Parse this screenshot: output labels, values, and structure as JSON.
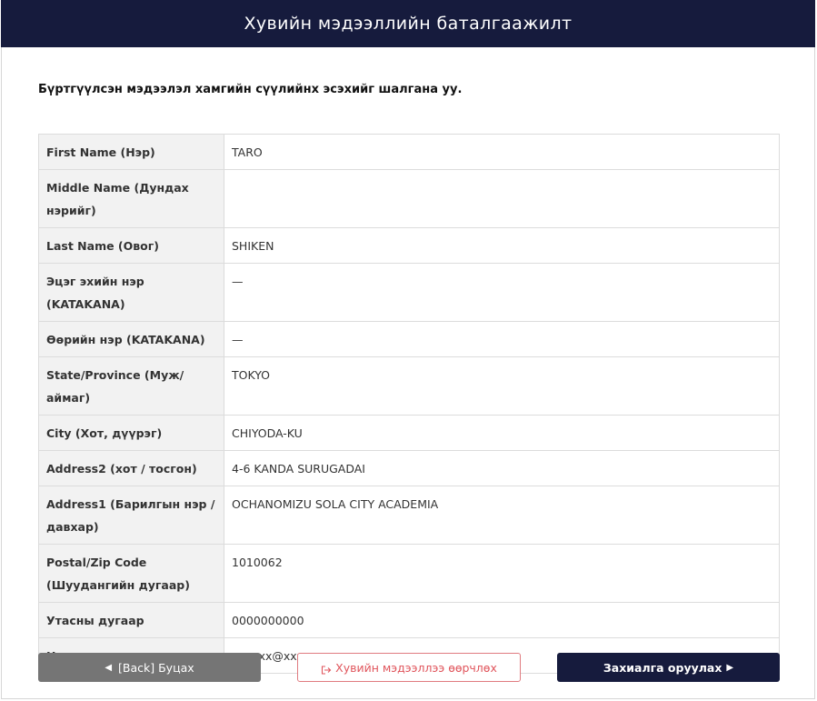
{
  "header": {
    "title": "Хувийн мэдээллийн баталгаажилт"
  },
  "intro": "Бүртгүүлсэн мэдээлэл хамгийн сүүлийнх эсэхийг шалгана уу.",
  "rows": [
    {
      "label": "First Name (Нэр)",
      "value": "TARO"
    },
    {
      "label": "Middle Name (Дундах нэрийг)",
      "value": ""
    },
    {
      "label": "Last Name (Овог)",
      "value": "SHIKEN"
    },
    {
      "label": "Эцэг эхийн нэр (KATAKANA)",
      "value": "—"
    },
    {
      "label": "Өөрийн нэр (KATAKANA)",
      "value": "—"
    },
    {
      "label": "State/Province (Муж/аймаг)",
      "value": "TOKYO"
    },
    {
      "label": "City (Хот, дүүрэг)",
      "value": "CHIYODA-KU"
    },
    {
      "label": "Address2 (хот / тосгон)",
      "value": "4-6 KANDA SURUGADAI"
    },
    {
      "label": "Address1 (Барилгын нэр / давхар)",
      "value": "OCHANOMIZU SOLA CITY ACADEMIA"
    },
    {
      "label": "Postal/Zip Code (Шуудангийн дугаар)",
      "value": "1010062"
    },
    {
      "label": "Утасны дугаар",
      "value": "0000000000"
    },
    {
      "label": "Цахим шуудан хаяг",
      "value": "xxxxxx@xxx.com"
    }
  ],
  "buttons": {
    "back": "[Back] Буцах",
    "edit": "Хувийн мэдээллээ өөрчлөх",
    "submit": "Захиалга оруулах"
  },
  "icons": {
    "back": "caret-left-icon",
    "edit": "sign-out-icon",
    "submit": "caret-right-icon"
  },
  "colors": {
    "header_bg": "#161b3d",
    "back_button_bg": "#757575",
    "edit_button_border": "#e07b80",
    "edit_button_text": "#e0555c",
    "submit_button_bg": "#161b3d",
    "label_cell_bg": "#f2f2f2"
  }
}
